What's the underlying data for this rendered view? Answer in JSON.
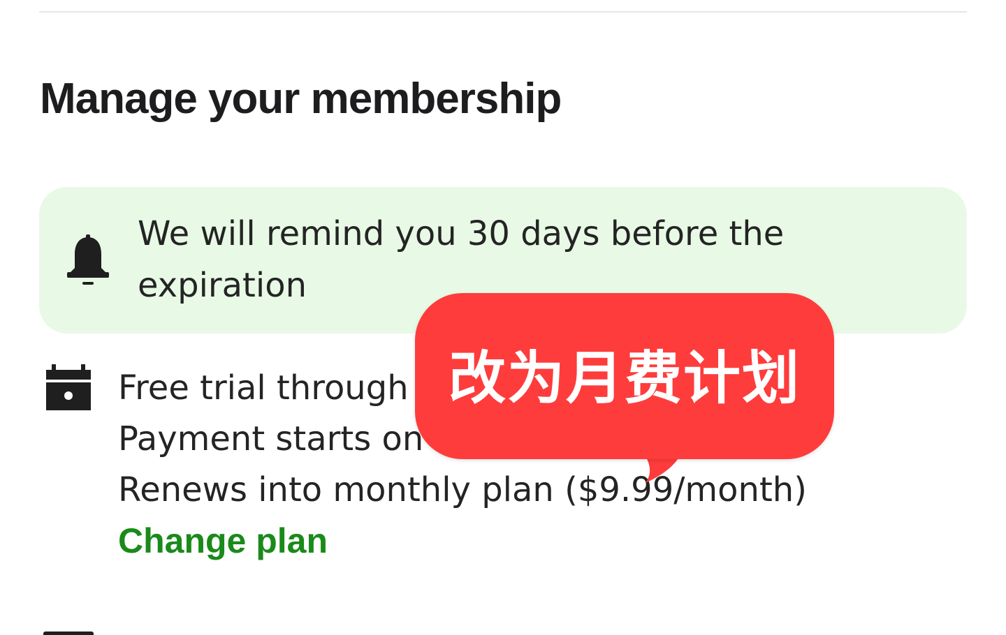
{
  "page": {
    "title": "Manage your membership"
  },
  "reminder": {
    "text": "We will remind you 30 days before the expiration",
    "icon": "bell-icon",
    "background_color": "#e8fae6"
  },
  "plan": {
    "icon": "calendar-icon",
    "free_trial_text": "Free trial through",
    "payment_text": "Payment starts on",
    "renews_text": "Renews into monthly plan  ($9.99/month)",
    "change_plan_label": "Change plan",
    "link_color": "#1a8a1a"
  },
  "annotation": {
    "text": "改为月费计划",
    "background_color": "#fe3c3c"
  }
}
